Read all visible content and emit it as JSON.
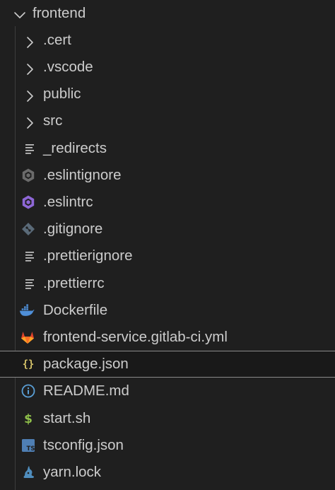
{
  "root": {
    "label": "frontend",
    "expanded": true
  },
  "items": [
    {
      "label": ".cert",
      "kind": "folder",
      "icon": "chevron-right-icon"
    },
    {
      "label": ".vscode",
      "kind": "folder",
      "icon": "chevron-right-icon"
    },
    {
      "label": "public",
      "kind": "folder",
      "icon": "chevron-right-icon"
    },
    {
      "label": "src",
      "kind": "folder",
      "icon": "chevron-right-icon"
    },
    {
      "label": "_redirects",
      "kind": "file",
      "icon": "text-lines-icon"
    },
    {
      "label": ".eslintignore",
      "kind": "file",
      "icon": "eslint-gray-icon"
    },
    {
      "label": ".eslintrc",
      "kind": "file",
      "icon": "eslint-icon"
    },
    {
      "label": ".gitignore",
      "kind": "file",
      "icon": "git-icon"
    },
    {
      "label": ".prettierignore",
      "kind": "file",
      "icon": "text-lines-icon"
    },
    {
      "label": ".prettierrc",
      "kind": "file",
      "icon": "text-lines-icon"
    },
    {
      "label": "Dockerfile",
      "kind": "file",
      "icon": "docker-icon"
    },
    {
      "label": "frontend-service.gitlab-ci.yml",
      "kind": "file",
      "icon": "gitlab-icon"
    },
    {
      "label": "package.json",
      "kind": "file",
      "icon": "json-braces-icon",
      "selected": true
    },
    {
      "label": "README.md",
      "kind": "file",
      "icon": "info-icon"
    },
    {
      "label": "start.sh",
      "kind": "file",
      "icon": "shell-dollar-icon"
    },
    {
      "label": "tsconfig.json",
      "kind": "file",
      "icon": "typescript-icon"
    },
    {
      "label": "yarn.lock",
      "kind": "file",
      "icon": "yarn-icon"
    }
  ],
  "colors": {
    "background": "#1f1f1f",
    "text": "#cccccc",
    "selection_border": "#8a8a8a",
    "eslint": "#8e67d6",
    "eslint_gray": "#6b6b6b",
    "git": "#5a6a78",
    "docker": "#4f8fd8",
    "gitlab": "#e2432a",
    "json": "#d7c56a",
    "info": "#5a9fd6",
    "shell": "#8fc04a",
    "typescript": "#4f7fb4",
    "yarn": "#4f8dbd"
  }
}
